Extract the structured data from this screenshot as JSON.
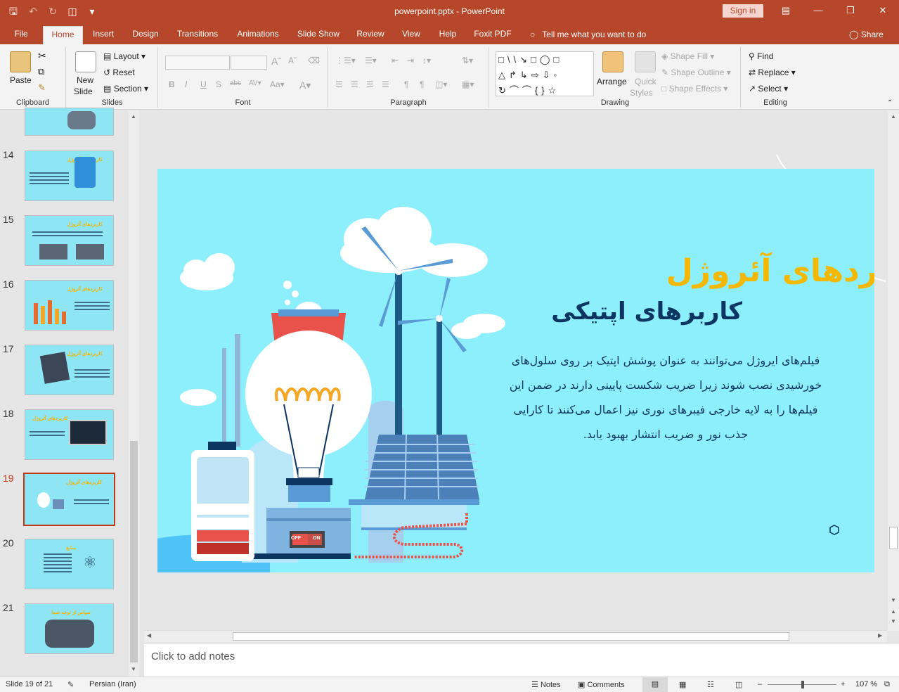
{
  "title_bar": {
    "document_title": "powerpoint.pptx  -  PowerPoint",
    "sign_in": "Sign in"
  },
  "tabs": [
    {
      "label": "File"
    },
    {
      "label": "Home"
    },
    {
      "label": "Insert"
    },
    {
      "label": "Design"
    },
    {
      "label": "Transitions"
    },
    {
      "label": "Animations"
    },
    {
      "label": "Slide Show"
    },
    {
      "label": "Review"
    },
    {
      "label": "View"
    },
    {
      "label": "Help"
    },
    {
      "label": "Foxit PDF"
    }
  ],
  "tell_me": "Tell me what you want to do",
  "share": "Share",
  "ribbon": {
    "clipboard": {
      "label": "Clipboard",
      "paste": "Paste"
    },
    "slides": {
      "label": "Slides",
      "new_slide_1": "New",
      "new_slide_2": "Slide",
      "layout": "Layout",
      "reset": "Reset",
      "section": "Section"
    },
    "font": {
      "label": "Font"
    },
    "paragraph": {
      "label": "Paragraph"
    },
    "drawing": {
      "label": "Drawing",
      "arrange": "Arrange",
      "quick_styles_1": "Quick",
      "quick_styles_2": "Styles",
      "shape_fill": "Shape Fill",
      "shape_outline": "Shape Outline",
      "shape_effects": "Shape Effects"
    },
    "editing": {
      "label": "Editing",
      "find": "Find",
      "replace": "Replace",
      "select": "Select"
    }
  },
  "thumbnails": [
    {
      "num": "14",
      "title": "کاربردهای آئروژل"
    },
    {
      "num": "15",
      "title": "کاربردهای آئروژل"
    },
    {
      "num": "16",
      "title": "کاربردهای آئروژل"
    },
    {
      "num": "17",
      "title": "کاربردهای آئروژل"
    },
    {
      "num": "18",
      "title": "کاربردهای آئروژل"
    },
    {
      "num": "19",
      "title": "کاربردهای آئروژل"
    },
    {
      "num": "20",
      "title": "منابع"
    },
    {
      "num": "21",
      "title": "سپاس از توجه شما"
    }
  ],
  "slide": {
    "title": "کاربردهای آئروژل",
    "subtitle": "کاربرهای اپتیکی",
    "body": "فیلم‌های ایروژل می‌توانند به عنوان پوشش اپتیک بر روی سلول‌های خورشیدی نصب شوند زیرا ضریب شکست پایینی دارند در ضمن این فیلم‌ها را به لایه خارجی فیبرهای نوری نیز اعمال می‌کنند تا کارایی جذب نور و ضریب انتشار بهبود یابد.",
    "switch_off": "OFF",
    "switch_on": "ON"
  },
  "notes_placeholder": "Click to add notes",
  "status": {
    "slide_of": "Slide 19 of 21",
    "language": "Persian (Iran)",
    "notes": "Notes",
    "comments": "Comments",
    "zoom": "107 %"
  },
  "colors": {
    "accent": "#b7472a",
    "slide_bg": "#8deffb",
    "title_yellow": "#f5b800",
    "navy": "#0d3561"
  }
}
